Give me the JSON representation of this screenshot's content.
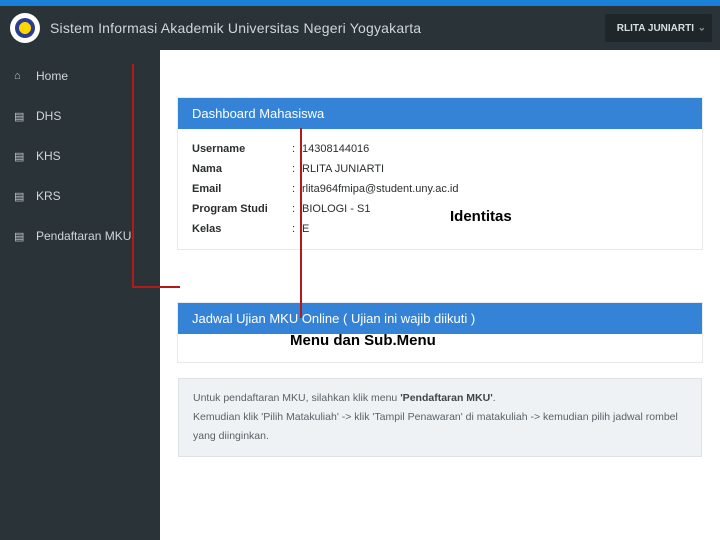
{
  "header": {
    "app_title": "Sistem Informasi Akademik Universitas Negeri Yogyakarta",
    "user_name": "RLITA JUNIARTI"
  },
  "sidebar": {
    "items": [
      {
        "label": "Home",
        "icon": "⌂"
      },
      {
        "label": "DHS",
        "icon": "▤"
      },
      {
        "label": "KHS",
        "icon": "▤"
      },
      {
        "label": "KRS",
        "icon": "▤"
      },
      {
        "label": "Pendaftaran MKU",
        "icon": "▤"
      }
    ]
  },
  "dashboard": {
    "title": "Dashboard Mahasiswa",
    "identity": {
      "username_label": "Username",
      "username_value": "14308144016",
      "nama_label": "Nama",
      "nama_value": "RLITA JUNIARTI",
      "email_label": "Email",
      "email_value": "rlita964fmipa@student.uny.ac.id",
      "prodi_label": "Program Studi",
      "prodi_value": "BIOLOGI - S1",
      "kelas_label": "Kelas",
      "kelas_value": "E"
    }
  },
  "jadwal": {
    "title": "Jadwal Ujian MKU Online ( Ujian ini wajib diikuti )"
  },
  "info": {
    "line1_a": "Untuk pendaftaran MKU, silahkan klik menu ",
    "line1_b": "'Pendaftaran MKU'",
    "line1_c": ".",
    "line2": "Kemudian klik 'Pilih Matakuliah' -> klik 'Tampil Penawaran' di matakuliah -> kemudian pilih jadwal rombel yang diinginkan."
  },
  "annotations": {
    "identitas": "Identitas",
    "menu_submenu": "Menu dan Sub.Menu"
  }
}
